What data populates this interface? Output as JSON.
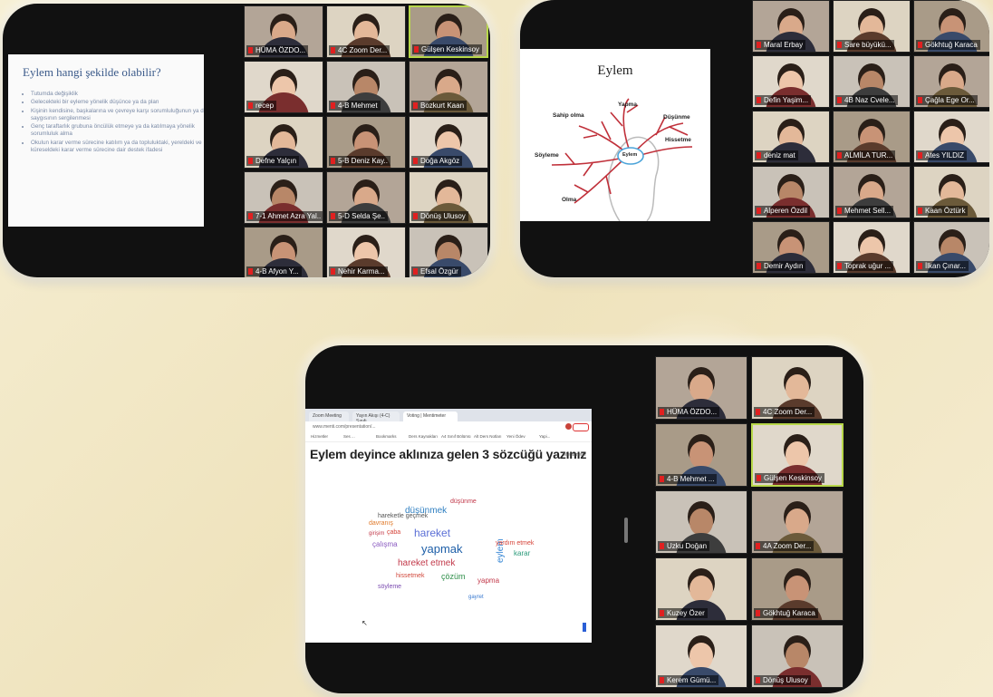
{
  "shot1": {
    "slide": {
      "title": "Eylem hangi şekilde olabilir?",
      "bullets": [
        "Tutumda değişiklik",
        "Gelecekteki bir eyleme yönelik düşünce ya da plan",
        "Kişinin kendisine, başkalarına ve çevreye karşı sorumluluğunun ya da saygısının sergilenmesi",
        "Genç taraftarlık grubuna öncülük etmeye ya da katılmaya yönelik sorumluluk alma",
        "Okulun karar verme sürecine katılım ya da topluluktaki, yereldeki ve küreseldeki karar verme sürecine dair destek ifadesi"
      ]
    },
    "participants": [
      "HÜMA ÖZDO...",
      "4C Zoom Der...",
      "Gülşen Keskinsoy",
      "recep",
      "4-B Mehmet",
      "Bozkurt Kaan",
      "Defne Yalçın",
      "5-B Deniz Kay..",
      "Doğa Akgöz",
      "7-1 Ahmet Azra Yal..",
      "5-D Selda Şe..",
      "Dönüş Ulusoy",
      "4-B Afyon Y...",
      "Nehir Karma...",
      "Efsal Özgür"
    ]
  },
  "shot2": {
    "slide": {
      "title": "Eylem",
      "center": "Eylem",
      "labels": [
        "Yapma",
        "Sahip olma",
        "Düşünme",
        "Hissetme",
        "Söyleme",
        "Olma"
      ]
    },
    "participants": [
      "Maral Erbay",
      "Sare büyükü...",
      "Gökhtuğ Karaca",
      "Defin Yaşim...",
      "4B Naz Cvele...",
      "Çağla Ege Or...",
      "deniz mat",
      "ALMİLA TUR...",
      "Ates YILDIZ",
      "Alperen Özdil",
      "Mehmet Sell...",
      "Kaan Öztürk",
      "Demir Aydın",
      "Toprak uğur ...",
      "İlkan Çınar..."
    ]
  },
  "shot3": {
    "tabs": [
      "Zoom Meeting",
      "Yayın Akışı (4-C) Sınıfı",
      "Voting | Mentimeter"
    ],
    "address": "www.menti.com/presentation/...",
    "bookmarks": [
      "Hizmetler",
      "Ses ...",
      "Bookmarks",
      "Ders Kaynakları",
      "A4 Sınıf Bölümü",
      "Alt Ders Notları",
      "Yeni Ödev",
      "Yapi..."
    ],
    "question": "Eylem deyince aklınıza gelen 3 sözcüğü yazınız",
    "brand": "Mentimeter",
    "words": [
      "düşünmek",
      "hareket",
      "yapmak",
      "çalışma",
      "hareket etmek",
      "çözüm",
      "hissetmek",
      "eylem",
      "yapma",
      "davranış",
      "söyleme",
      "karar",
      "düşünme",
      "yardım etmek",
      "çaba",
      "girişim",
      "hareketle geçmek",
      "gayret"
    ],
    "participants": [
      "HÜMA ÖZDO...",
      "4C Zoom Der...",
      "4-B Mehmet ...",
      "Gülşen Keskinsoy",
      "Uzku Doğan",
      "4A Zoom Der...",
      "Kuzey Özer",
      "Gökhtuğ Karaca",
      "Kerem Gümü...",
      "Dönüş Ulusoy"
    ]
  },
  "colors": {
    "background": "#f4ecce",
    "frame": "#111111",
    "active_speaker": "#b8d84a",
    "muted_icon": "#e02020",
    "slide_title_blue": "#3b5a8a",
    "mind_map_lines": "#c0303a"
  }
}
